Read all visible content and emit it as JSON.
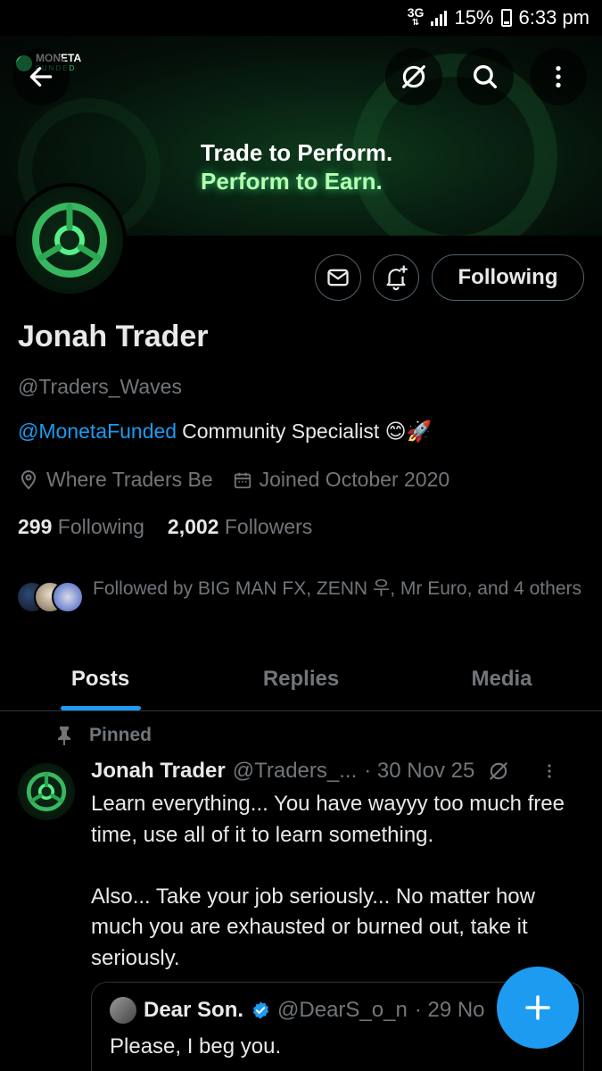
{
  "status_bar": {
    "network": "3G",
    "battery": "15%",
    "time": "6:33 pm"
  },
  "banner": {
    "brand_name": "MONETA",
    "brand_sub": "FUNDED",
    "tagline_1": "Trade to Perform.",
    "tagline_2": "Perform to Earn."
  },
  "profile": {
    "name": "Jonah Trader",
    "handle": "@Traders_Waves",
    "bio_mention": "@MonetaFunded",
    "bio_text": "Community Specialist 😊🚀",
    "location": "Where Traders Be",
    "joined": "Joined October 2020",
    "following_count": "299",
    "following_label": "Following",
    "followers_count": "2,002",
    "followers_label": "Followers",
    "followed_by": "Followed by BIG MAN FX, ZENN 우, Mr Euro, and 4 others",
    "following_button": "Following"
  },
  "tabs": [
    {
      "label": "Posts",
      "active": true
    },
    {
      "label": "Replies",
      "active": false
    },
    {
      "label": "Media",
      "active": false
    }
  ],
  "pinned_post": {
    "pinned_label": "Pinned",
    "author_name": "Jonah Trader",
    "author_handle": "@Traders_...",
    "date": "· 30 Nov 25",
    "paragraph_1": "Learn everything... You have wayyy too much free time, use all of it to learn something.",
    "paragraph_2": "Also... Take your job seriously... No matter how much you are exhausted or burned out, take it seriously.",
    "quote": {
      "name": "Dear Son.",
      "handle": "@DearS_o_n",
      "date": "· 29 No",
      "text": "Please, I beg you."
    }
  },
  "colors": {
    "accent": "#1d9bf0",
    "muted": "#71767b",
    "text": "#e7e9ea",
    "border": "#2f3336",
    "brand_green": "#2ecc71"
  }
}
